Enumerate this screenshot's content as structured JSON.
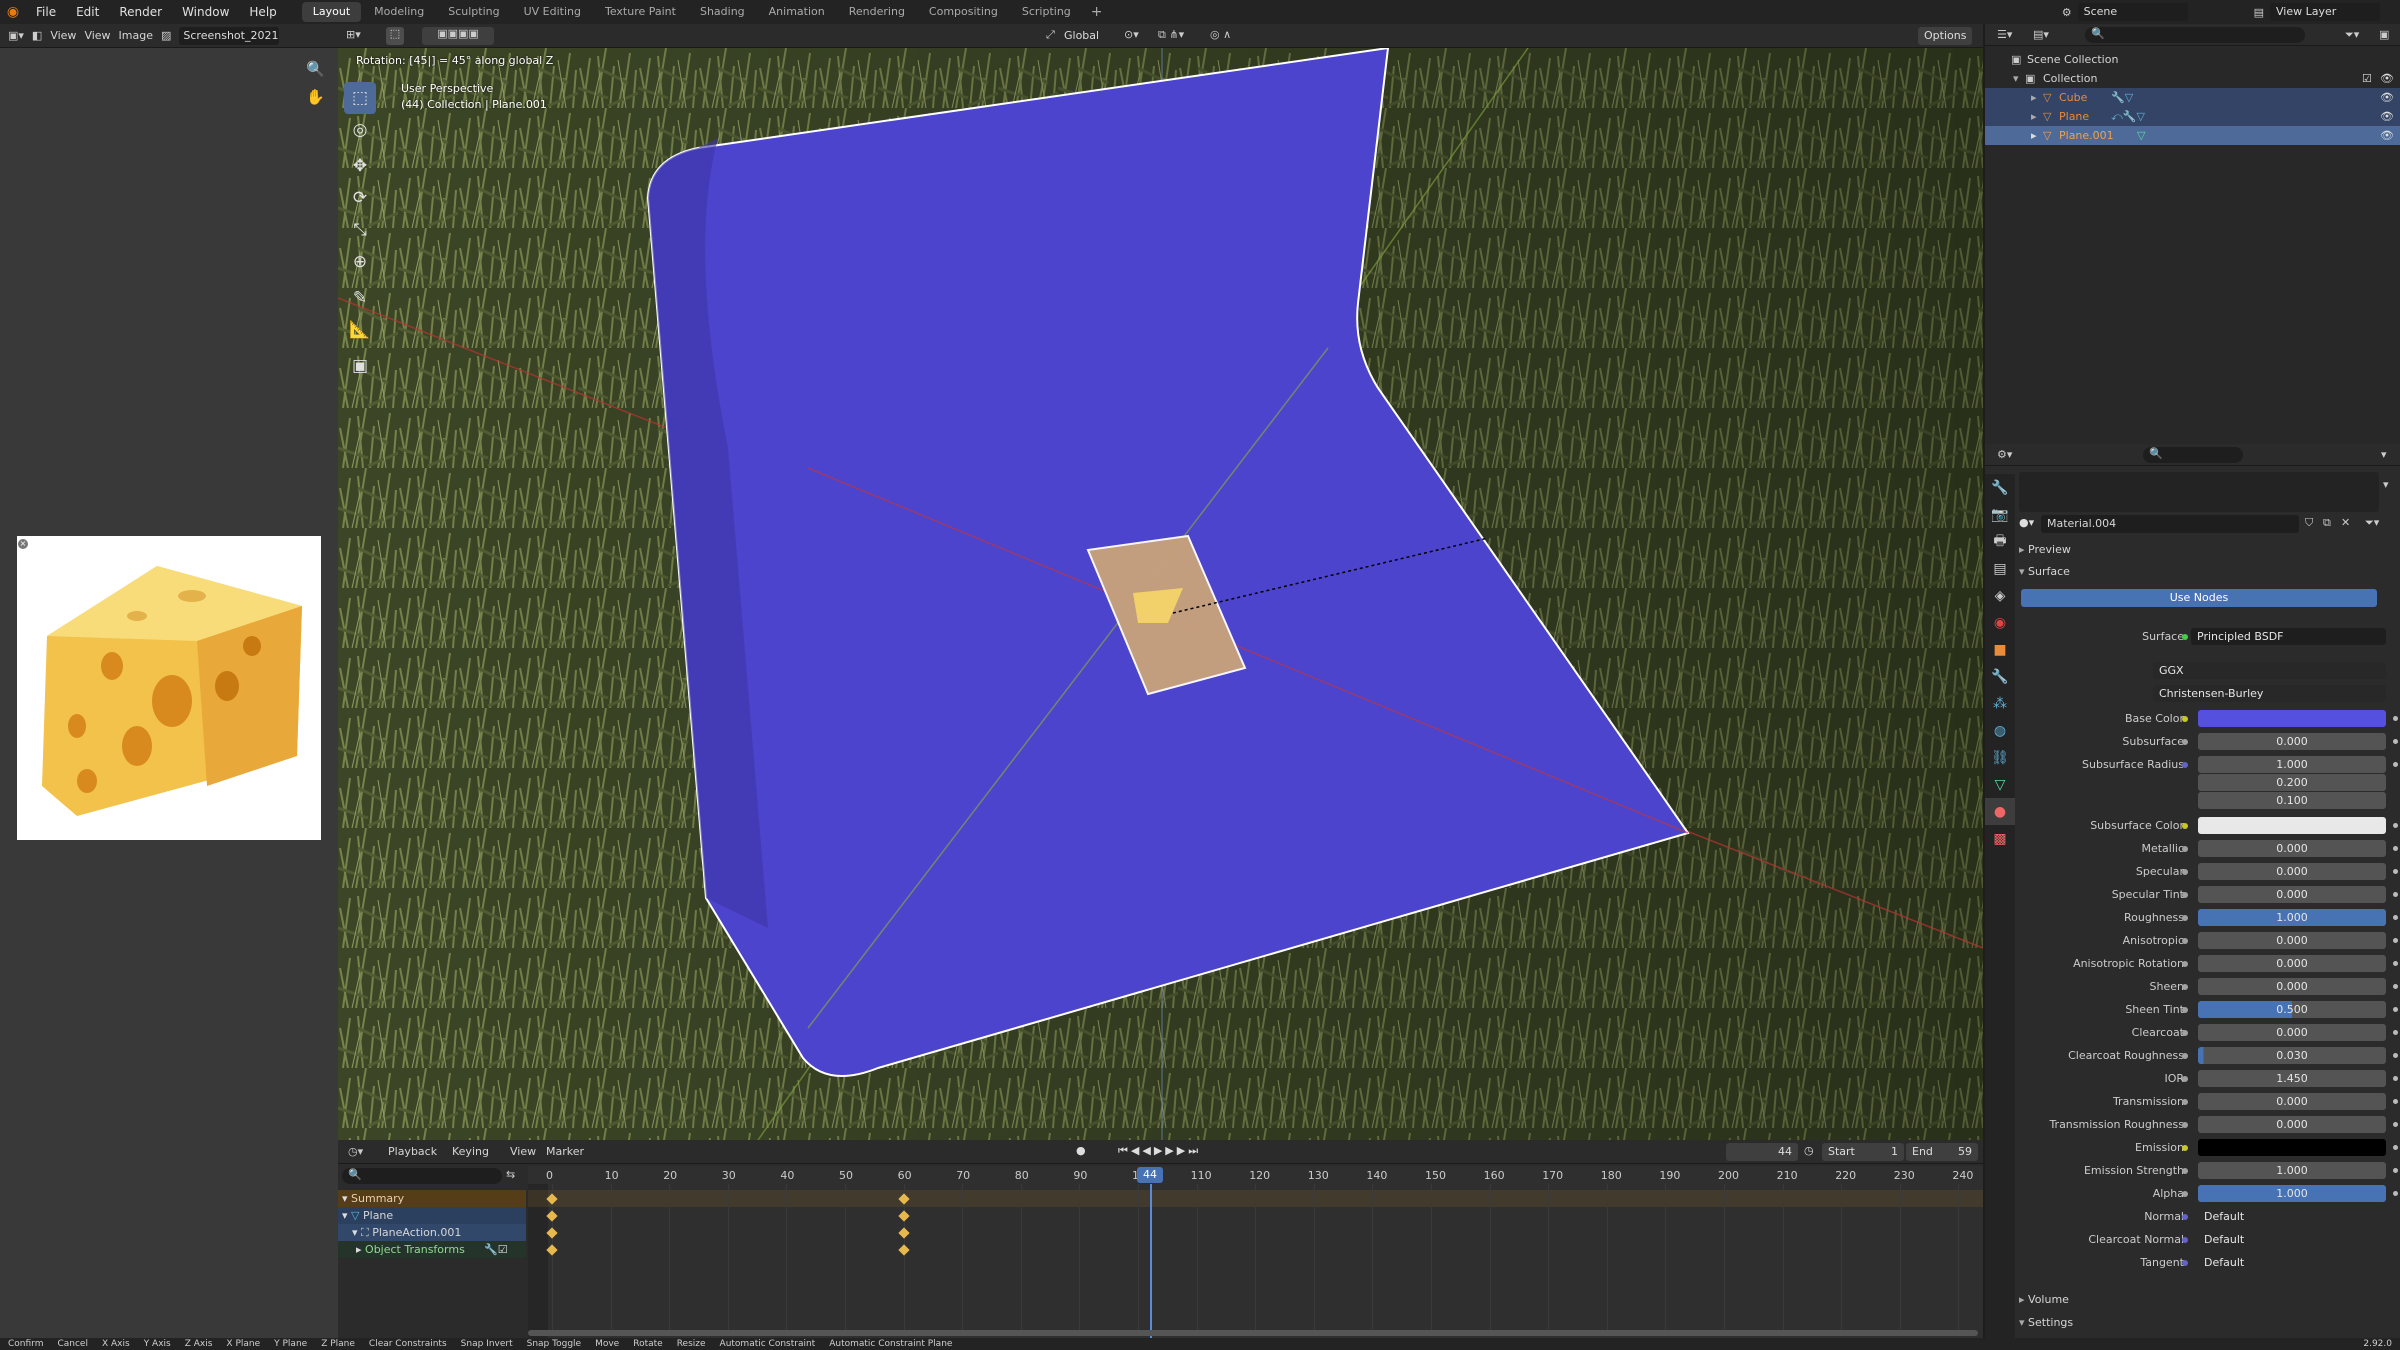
{
  "menu": {
    "items": [
      "File",
      "Edit",
      "Render",
      "Window",
      "Help"
    ]
  },
  "workspaces": [
    "Layout",
    "Modeling",
    "Sculpting",
    "UV Editing",
    "Texture Paint",
    "Shading",
    "Animation",
    "Rendering",
    "Compositing",
    "Scripting"
  ],
  "active_workspace": "Layout",
  "scene": {
    "label": "Scene",
    "view_layer": "View Layer"
  },
  "image_editor": {
    "menus": [
      "View",
      "View",
      "Image"
    ],
    "filename": "Screenshot_2021-0..."
  },
  "viewport": {
    "op_text": "Rotation: [45|] = 45° along global Z",
    "perspective": "User Perspective",
    "collection_line": "(44) Collection | Plane.001",
    "orientation": "Global",
    "options": "Options"
  },
  "outliner": {
    "scene_collection": "Scene Collection",
    "collection": "Collection",
    "objects": [
      "Cube",
      "Plane",
      "Plane.001"
    ]
  },
  "properties": {
    "material": "Material.004",
    "preview": "Preview",
    "surface_panel": "Surface",
    "use_nodes": "Use Nodes",
    "surface_shader": "Principled BSDF",
    "distribution": "GGX",
    "subsurface_method": "Christensen-Burley",
    "rows": [
      {
        "label": "Base Color",
        "value": ""
      },
      {
        "label": "Subsurface",
        "value": "0.000"
      },
      {
        "label": "Subsurface Radius",
        "value": "1.000"
      },
      {
        "label": "",
        "value": "0.200"
      },
      {
        "label": "",
        "value": "0.100"
      },
      {
        "label": "Subsurface Color",
        "value": ""
      },
      {
        "label": "Metallic",
        "value": "0.000"
      },
      {
        "label": "Specular",
        "value": "0.000"
      },
      {
        "label": "Specular Tint",
        "value": "0.000"
      },
      {
        "label": "Roughness",
        "value": "1.000"
      },
      {
        "label": "Anisotropic",
        "value": "0.000"
      },
      {
        "label": "Anisotropic Rotation",
        "value": "0.000"
      },
      {
        "label": "Sheen",
        "value": "0.000"
      },
      {
        "label": "Sheen Tint",
        "value": "0.500"
      },
      {
        "label": "Clearcoat",
        "value": "0.000"
      },
      {
        "label": "Clearcoat Roughness",
        "value": "0.030"
      },
      {
        "label": "IOR",
        "value": "1.450"
      },
      {
        "label": "Transmission",
        "value": "0.000"
      },
      {
        "label": "Transmission Roughness",
        "value": "0.000"
      },
      {
        "label": "Emission",
        "value": ""
      },
      {
        "label": "Emission Strength",
        "value": "1.000"
      },
      {
        "label": "Alpha",
        "value": "1.000"
      },
      {
        "label": "Normal",
        "value": "Default"
      },
      {
        "label": "Clearcoat Normal",
        "value": "Default"
      },
      {
        "label": "Tangent",
        "value": "Default"
      }
    ],
    "volume": "Volume",
    "settings": "Settings",
    "colors": {
      "base_color": "#5550dd",
      "subsurface_color": "#e8e8e8",
      "emission": "#000000",
      "accent": "#4772b3"
    }
  },
  "timeline": {
    "menus": [
      "Playback",
      "Keying",
      "View",
      "Marker"
    ],
    "current_frame": "44",
    "start_label": "Start",
    "start": "1",
    "end_label": "End",
    "end": "59",
    "ticks": [
      "0",
      "10",
      "20",
      "30",
      "40",
      "50",
      "60",
      "70",
      "80",
      "90",
      "100",
      "110",
      "120",
      "130",
      "140",
      "150",
      "160",
      "170",
      "180",
      "190",
      "200",
      "210",
      "220",
      "230",
      "240"
    ],
    "channels": [
      "Summary",
      "Plane",
      "PlaneAction.001",
      "Object Transforms"
    ]
  },
  "statusbar": [
    "Confirm",
    "Cancel",
    "X Axis",
    "Y Axis",
    "Z Axis",
    "X Plane",
    "Y Plane",
    "Z Plane",
    "Clear Constraints",
    "Snap Invert",
    "Snap Toggle",
    "Move",
    "Rotate",
    "Resize",
    "Automatic Constraint",
    "Automatic Constraint Plane"
  ],
  "version": "2.92.0"
}
